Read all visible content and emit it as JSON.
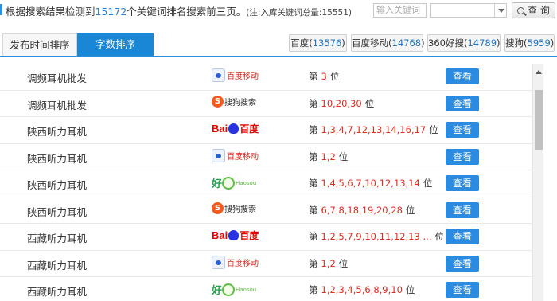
{
  "header": {
    "summary_prefix": "根据搜索结果检测到",
    "summary_count": "15172",
    "summary_suffix": "个关键词排名搜索前三页。",
    "summary_note": "(注:入库关键词总量:15551)",
    "keyword_placeholder": "输入关键词",
    "query_button": "查 询"
  },
  "tabs": [
    {
      "label": "发布时间排序",
      "active": false
    },
    {
      "label": "字数排序",
      "active": true
    }
  ],
  "engines": [
    {
      "name": "百度",
      "count": "13576"
    },
    {
      "name": "百度移动",
      "count": "14768"
    },
    {
      "name": "360好搜",
      "count": "14789"
    },
    {
      "name": "搜狗",
      "count": "5959"
    }
  ],
  "rank_prefix": "第",
  "rank_suffix": "位",
  "view_label": "查看",
  "logos": {
    "baidu_mobile": "百度移动",
    "sogou_mark": "S",
    "sogou": "搜狗搜索",
    "baidu_bai": "Bai",
    "baidu_du": "百度",
    "haosou_char": "好",
    "haosou_en": "Haosou"
  },
  "rows": [
    {
      "keyword": "调频耳机批发",
      "engine": "baidu_mobile",
      "positions": "3"
    },
    {
      "keyword": "调频耳机批发",
      "engine": "sogou",
      "positions": "10,20,30"
    },
    {
      "keyword": "陕西听力耳机",
      "engine": "baidu",
      "positions": "1,3,4,7,12,13,14,16,17"
    },
    {
      "keyword": "陕西听力耳机",
      "engine": "baidu_mobile",
      "positions": "1,2"
    },
    {
      "keyword": "陕西听力耳机",
      "engine": "haosou",
      "positions": "1,4,5,6,7,10,12,13,14"
    },
    {
      "keyword": "陕西听力耳机",
      "engine": "sogou",
      "positions": "6,7,8,18,19,20,28"
    },
    {
      "keyword": "西藏听力耳机",
      "engine": "baidu",
      "positions": "1,2,5,7,9,10,11,12,13 ..."
    },
    {
      "keyword": "西藏听力耳机",
      "engine": "baidu_mobile",
      "positions": "1,2"
    },
    {
      "keyword": "西藏听力耳机",
      "engine": "haosou",
      "positions": "1,2,3,4,5,6,8,9,10"
    }
  ],
  "colors": {
    "accent": "#1a87d6",
    "rank_red": "#e02b1f",
    "view_button": "#2b8be0"
  }
}
